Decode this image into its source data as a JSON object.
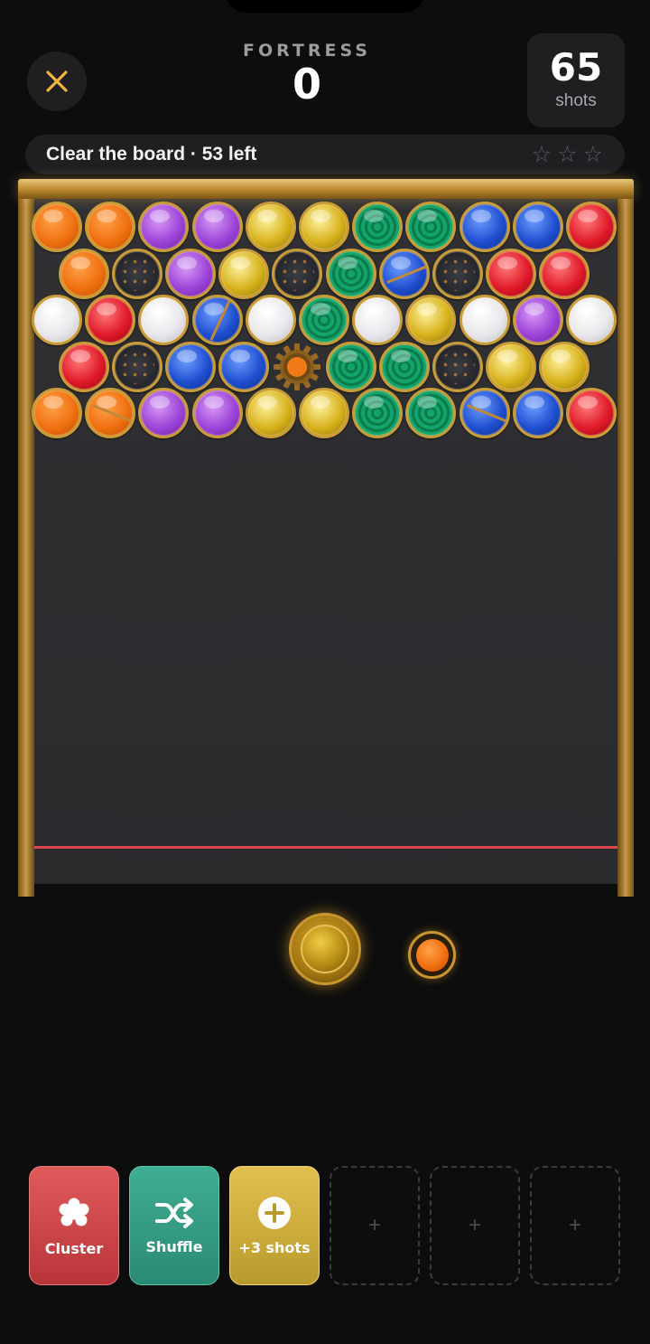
{
  "header": {
    "close_icon": "close-x-icon",
    "level_name": "FORTRESS",
    "score": "0",
    "shots_count": "65",
    "shots_label": "shots"
  },
  "objective": {
    "text": "Clear the board · 53 left",
    "stars": [
      "☆",
      "☆",
      "☆"
    ],
    "stars_earned": 0
  },
  "board": {
    "rows": [
      [
        "orange",
        "orange",
        "purple",
        "purple",
        "gold",
        "gold",
        "green",
        "green",
        "blue",
        "blue",
        "red"
      ],
      [
        "orange",
        "stone",
        "purple",
        "gold",
        "stone",
        "green",
        "blue-cracked",
        "stone",
        "red",
        "red"
      ],
      [
        "white",
        "red",
        "white",
        "blue-cracked",
        "white",
        "green",
        "white",
        "gold",
        "white",
        "purple",
        "white"
      ],
      [
        "red",
        "stone",
        "blue",
        "blue",
        "gear",
        "green",
        "green",
        "stone",
        "gold",
        "gold"
      ],
      [
        "orange",
        "orange-cracked",
        "purple",
        "purple",
        "gold",
        "gold",
        "green",
        "green",
        "blue-cracked",
        "blue",
        "red"
      ]
    ]
  },
  "shooter": {
    "current": "gold",
    "next": "orange"
  },
  "powerups": [
    {
      "label": "Cluster",
      "icon": "cluster-icon",
      "color": "#d24a4e"
    },
    {
      "label": "Shuffle",
      "icon": "shuffle-icon",
      "color": "#34a086"
    },
    {
      "label": "+3 shots",
      "icon": "plus-circle-icon",
      "color": "#d0b040"
    }
  ],
  "empty_slots": [
    "+",
    "+",
    "+"
  ],
  "colors": {
    "background": "#0d0d0e",
    "frame_gold": "#c79a4a",
    "danger_line": "#d9464c",
    "panel": "#1f1f22"
  }
}
